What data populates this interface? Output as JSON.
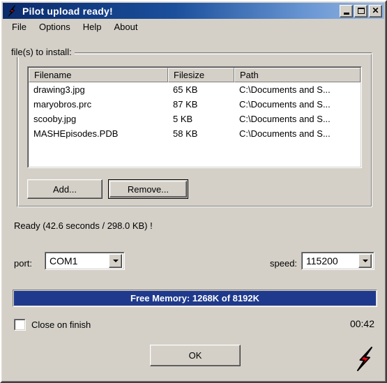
{
  "window": {
    "title": "Pilot upload ready!",
    "title_icon": "lightning-bolt-icon",
    "buttons": {
      "minimize": "_",
      "maximize": "□",
      "close": "×"
    }
  },
  "menu": {
    "items": [
      {
        "label": "File"
      },
      {
        "label": "Options"
      },
      {
        "label": "Help"
      },
      {
        "label": "About"
      }
    ]
  },
  "groupbox": {
    "label": "file(s) to install:"
  },
  "filelist": {
    "columns": [
      "Filename",
      "Filesize",
      "Path"
    ],
    "rows": [
      {
        "filename": "drawing3.jpg",
        "filesize": "65 KB",
        "path": "C:\\Documents and S..."
      },
      {
        "filename": "maryobros.prc",
        "filesize": "87 KB",
        "path": "C:\\Documents and S..."
      },
      {
        "filename": "scooby.jpg",
        "filesize": "5 KB",
        "path": "C:\\Documents and S..."
      },
      {
        "filename": "MASHEpisodes.PDB",
        "filesize": "58 KB",
        "path": "C:\\Documents and S..."
      }
    ]
  },
  "actions": {
    "add_label": "Add...",
    "remove_label": "Remove...",
    "ok_label": "OK"
  },
  "status": {
    "text": "Ready (42.6 seconds / 298.0 KB) !"
  },
  "connection": {
    "port_label": "port:",
    "port_value": "COM1",
    "speed_label": "speed:",
    "speed_value": "115200"
  },
  "progress": {
    "label": "Free Memory: 1268K of 8192K",
    "fill_percent": 100,
    "fill_color": "#1f3a8c",
    "text_color": "#ffffff"
  },
  "footer": {
    "close_on_finish_label": "Close on finish",
    "close_on_finish_checked": false,
    "timer": "00:42",
    "logo": "lightning-bolt-logo"
  },
  "colors": {
    "face": "#d4d0c8",
    "title_start": "#0a2a6b",
    "title_end": "#97b6e0",
    "accent_red": "#e8091a"
  }
}
